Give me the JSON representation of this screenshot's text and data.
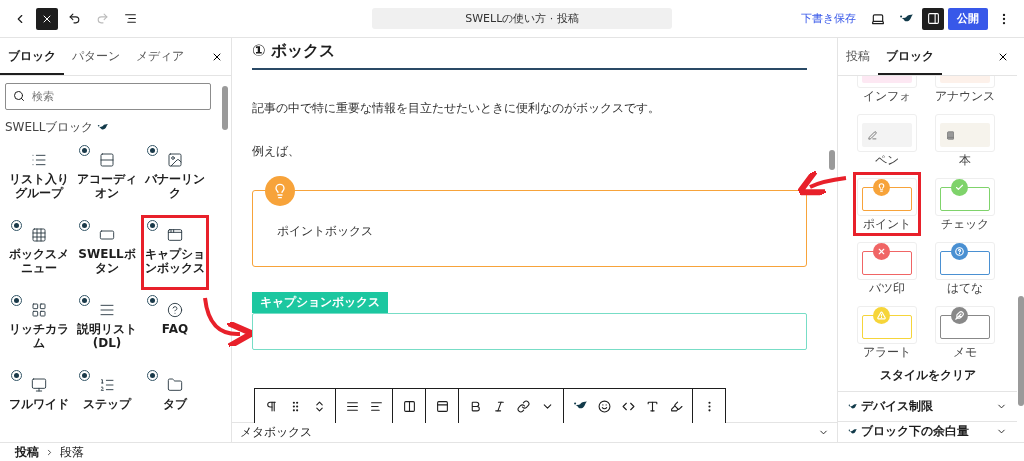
{
  "topbar": {
    "title": "SWELLの使い方 · 投稿",
    "save_draft": "下書き保存",
    "publish": "公開",
    "redo_disabled": true
  },
  "left_panel": {
    "tabs": [
      {
        "label": "ブロック",
        "selected": true
      },
      {
        "label": "パターン",
        "selected": false
      },
      {
        "label": "メディア",
        "selected": false
      }
    ],
    "search": {
      "placeholder": "検索"
    },
    "category": "SWELLブロック",
    "blocks": [
      {
        "label": "リスト入りグループ",
        "badge": false,
        "highlighted": false
      },
      {
        "label": "アコーディオン",
        "badge": true,
        "highlighted": false
      },
      {
        "label": "バナーリンク",
        "badge": true,
        "highlighted": false
      },
      {
        "label": "ボックスメニュー",
        "badge": true,
        "highlighted": false
      },
      {
        "label": "SWELLボタン",
        "badge": true,
        "highlighted": false
      },
      {
        "label": "キャプションボックス",
        "badge": true,
        "highlighted": true
      },
      {
        "label": "リッチカラム",
        "badge": true,
        "highlighted": false
      },
      {
        "label": "説明リスト\n(DL)",
        "badge": true,
        "highlighted": false
      },
      {
        "label": "FAQ",
        "badge": true,
        "highlighted": false
      },
      {
        "label": "フルワイド",
        "badge": true,
        "highlighted": false
      },
      {
        "label": "ステップ",
        "badge": true,
        "highlighted": false
      },
      {
        "label": "タブ",
        "badge": true,
        "highlighted": false
      }
    ]
  },
  "content": {
    "heading": "① ボックス",
    "paragraphs": [
      "記事の中で特に重要な情報を目立たせたいときに便利なのがボックスです。",
      "例えば、"
    ],
    "point_box": {
      "text": "ポイントボックス",
      "color": "#f7a33a"
    },
    "caption_box": {
      "caption": "キャプションボックス",
      "color": "#1cc7a0"
    },
    "metabox": "メタボックス"
  },
  "right_panel": {
    "tabs": [
      {
        "label": "投稿",
        "selected": false
      },
      {
        "label": "ブロック",
        "selected": true
      }
    ],
    "styles": [
      {
        "label": "インフォ",
        "kind": "cut",
        "color": "#fde8f3",
        "highlighted": false
      },
      {
        "label": "アナウンス",
        "kind": "cut",
        "color": "#fdf1ea",
        "highlighted": false
      },
      {
        "label": "ペン",
        "kind": "pen",
        "color": "#f3f3f3",
        "highlighted": false
      },
      {
        "label": "本",
        "kind": "book",
        "color": "#f6f3ec",
        "highlighted": false
      },
      {
        "label": "ポイント",
        "kind": "point",
        "color": "#f7a33a",
        "highlighted": true
      },
      {
        "label": "チェック",
        "kind": "check",
        "color": "#7fd36b",
        "highlighted": false
      },
      {
        "label": "バツ印",
        "kind": "cross",
        "color": "#f06565",
        "highlighted": false
      },
      {
        "label": "はてな",
        "kind": "question",
        "color": "#4a90d2",
        "highlighted": false
      },
      {
        "label": "アラート",
        "kind": "alert",
        "color": "#f6d53a",
        "highlighted": false
      },
      {
        "label": "メモ",
        "kind": "memo",
        "color": "#888888",
        "highlighted": false
      }
    ],
    "clear_style": "スタイルをクリア",
    "sections": [
      "デバイス制限",
      "ブロック下の余白量"
    ]
  },
  "breadcrumb": [
    "投稿",
    "段落"
  ]
}
